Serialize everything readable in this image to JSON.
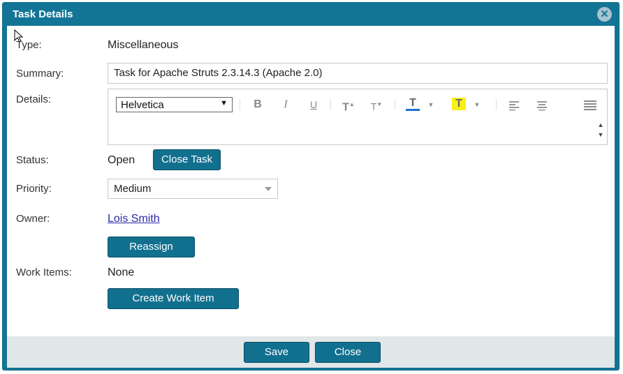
{
  "dialog": {
    "title": "Task Details",
    "close_icon_glyph": "✕"
  },
  "fields": {
    "type_label": "Type:",
    "type_value": "Miscellaneous",
    "summary_label": "Summary:",
    "summary_value": "Task for Apache Struts 2.3.14.3 (Apache 2.0)",
    "details_label": "Details:",
    "status_label": "Status:",
    "status_value": "Open",
    "close_task_label": "Close Task",
    "priority_label": "Priority:",
    "priority_value": "Medium",
    "owner_label": "Owner:",
    "owner_value": "Lois Smith",
    "reassign_label": "Reassign",
    "work_items_label": "Work Items:",
    "work_items_value": "None",
    "create_work_item_label": "Create Work Item"
  },
  "editor": {
    "font": "Helvetica",
    "toolbar_icons": [
      "bold-icon",
      "italic-icon",
      "underline-icon",
      "superscript-icon",
      "subscript-icon",
      "text-color-icon",
      "highlight-color-icon",
      "align-left-icon",
      "align-center-icon",
      "justify-icon"
    ]
  },
  "footer": {
    "save_label": "Save",
    "close_label": "Close"
  },
  "colors": {
    "titlebar": "#127596",
    "button": "#12708f",
    "footer": "#e1e6e8",
    "highlight": "#f7f01a",
    "text_color_underline": "#1f6fd1"
  }
}
